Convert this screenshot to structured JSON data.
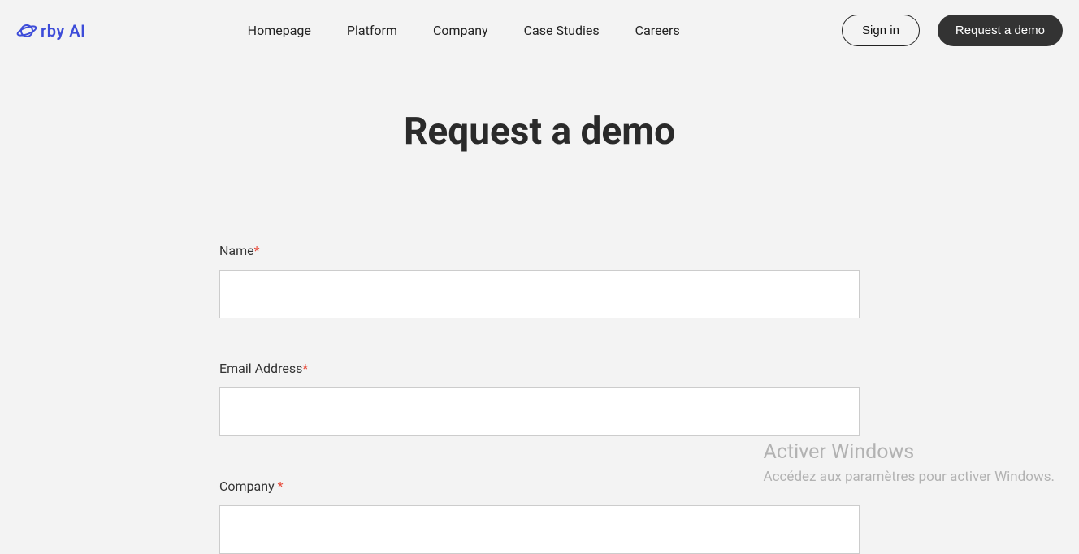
{
  "brand": {
    "name": "rby AI"
  },
  "nav": {
    "items": [
      {
        "label": "Homepage"
      },
      {
        "label": "Platform"
      },
      {
        "label": "Company"
      },
      {
        "label": "Case Studies"
      },
      {
        "label": "Careers"
      }
    ]
  },
  "actions": {
    "signin": "Sign in",
    "demo": "Request a demo"
  },
  "page": {
    "title": "Request a demo"
  },
  "form": {
    "fields": [
      {
        "label": "Name",
        "required": "*",
        "value": ""
      },
      {
        "label": "Email Address",
        "required": "*",
        "value": ""
      },
      {
        "label": "Company ",
        "required": "*",
        "value": ""
      }
    ]
  },
  "watermark": {
    "title": "Activer Windows",
    "sub": "Accédez aux paramètres pour activer Windows."
  }
}
